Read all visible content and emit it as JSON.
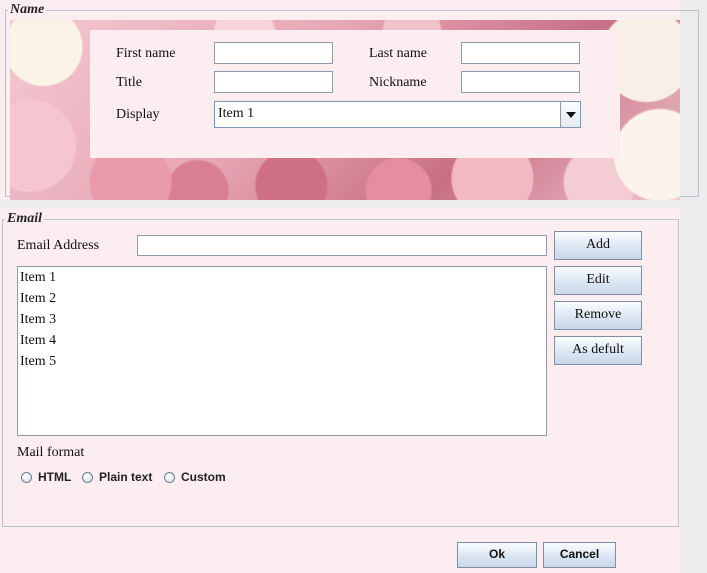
{
  "name_section": {
    "legend": "Name",
    "first_name_label": "First name",
    "last_name_label": "Last name",
    "title_label": "Title",
    "nickname_label": "Nickname",
    "display_label": "Display",
    "display_value": "Item 1",
    "first_name_value": "",
    "last_name_value": "",
    "title_value": "",
    "nickname_value": ""
  },
  "email_section": {
    "legend": "Email",
    "email_address_label": "Email Address",
    "email_value": "",
    "buttons": {
      "add": "Add",
      "edit": "Edit",
      "remove": "Remove",
      "as_default": "As defult"
    },
    "items": [
      "Item 1",
      "Item 2",
      "Item 3",
      "Item 4",
      "Item 5"
    ],
    "mail_format_label": "Mail format",
    "formats": [
      "HTML",
      "Plain text",
      "Custom"
    ]
  },
  "footer": {
    "ok": "Ok",
    "cancel": "Cancel"
  },
  "icons": {
    "dropdown": "chevron-down-icon",
    "radio": "radio-unchecked-icon"
  },
  "colors": {
    "panel_background": "#fcedf0",
    "border": "#b9c4d2",
    "button_gradient_top": "#fbfdff",
    "button_gradient_bottom": "#c9d7e8"
  }
}
